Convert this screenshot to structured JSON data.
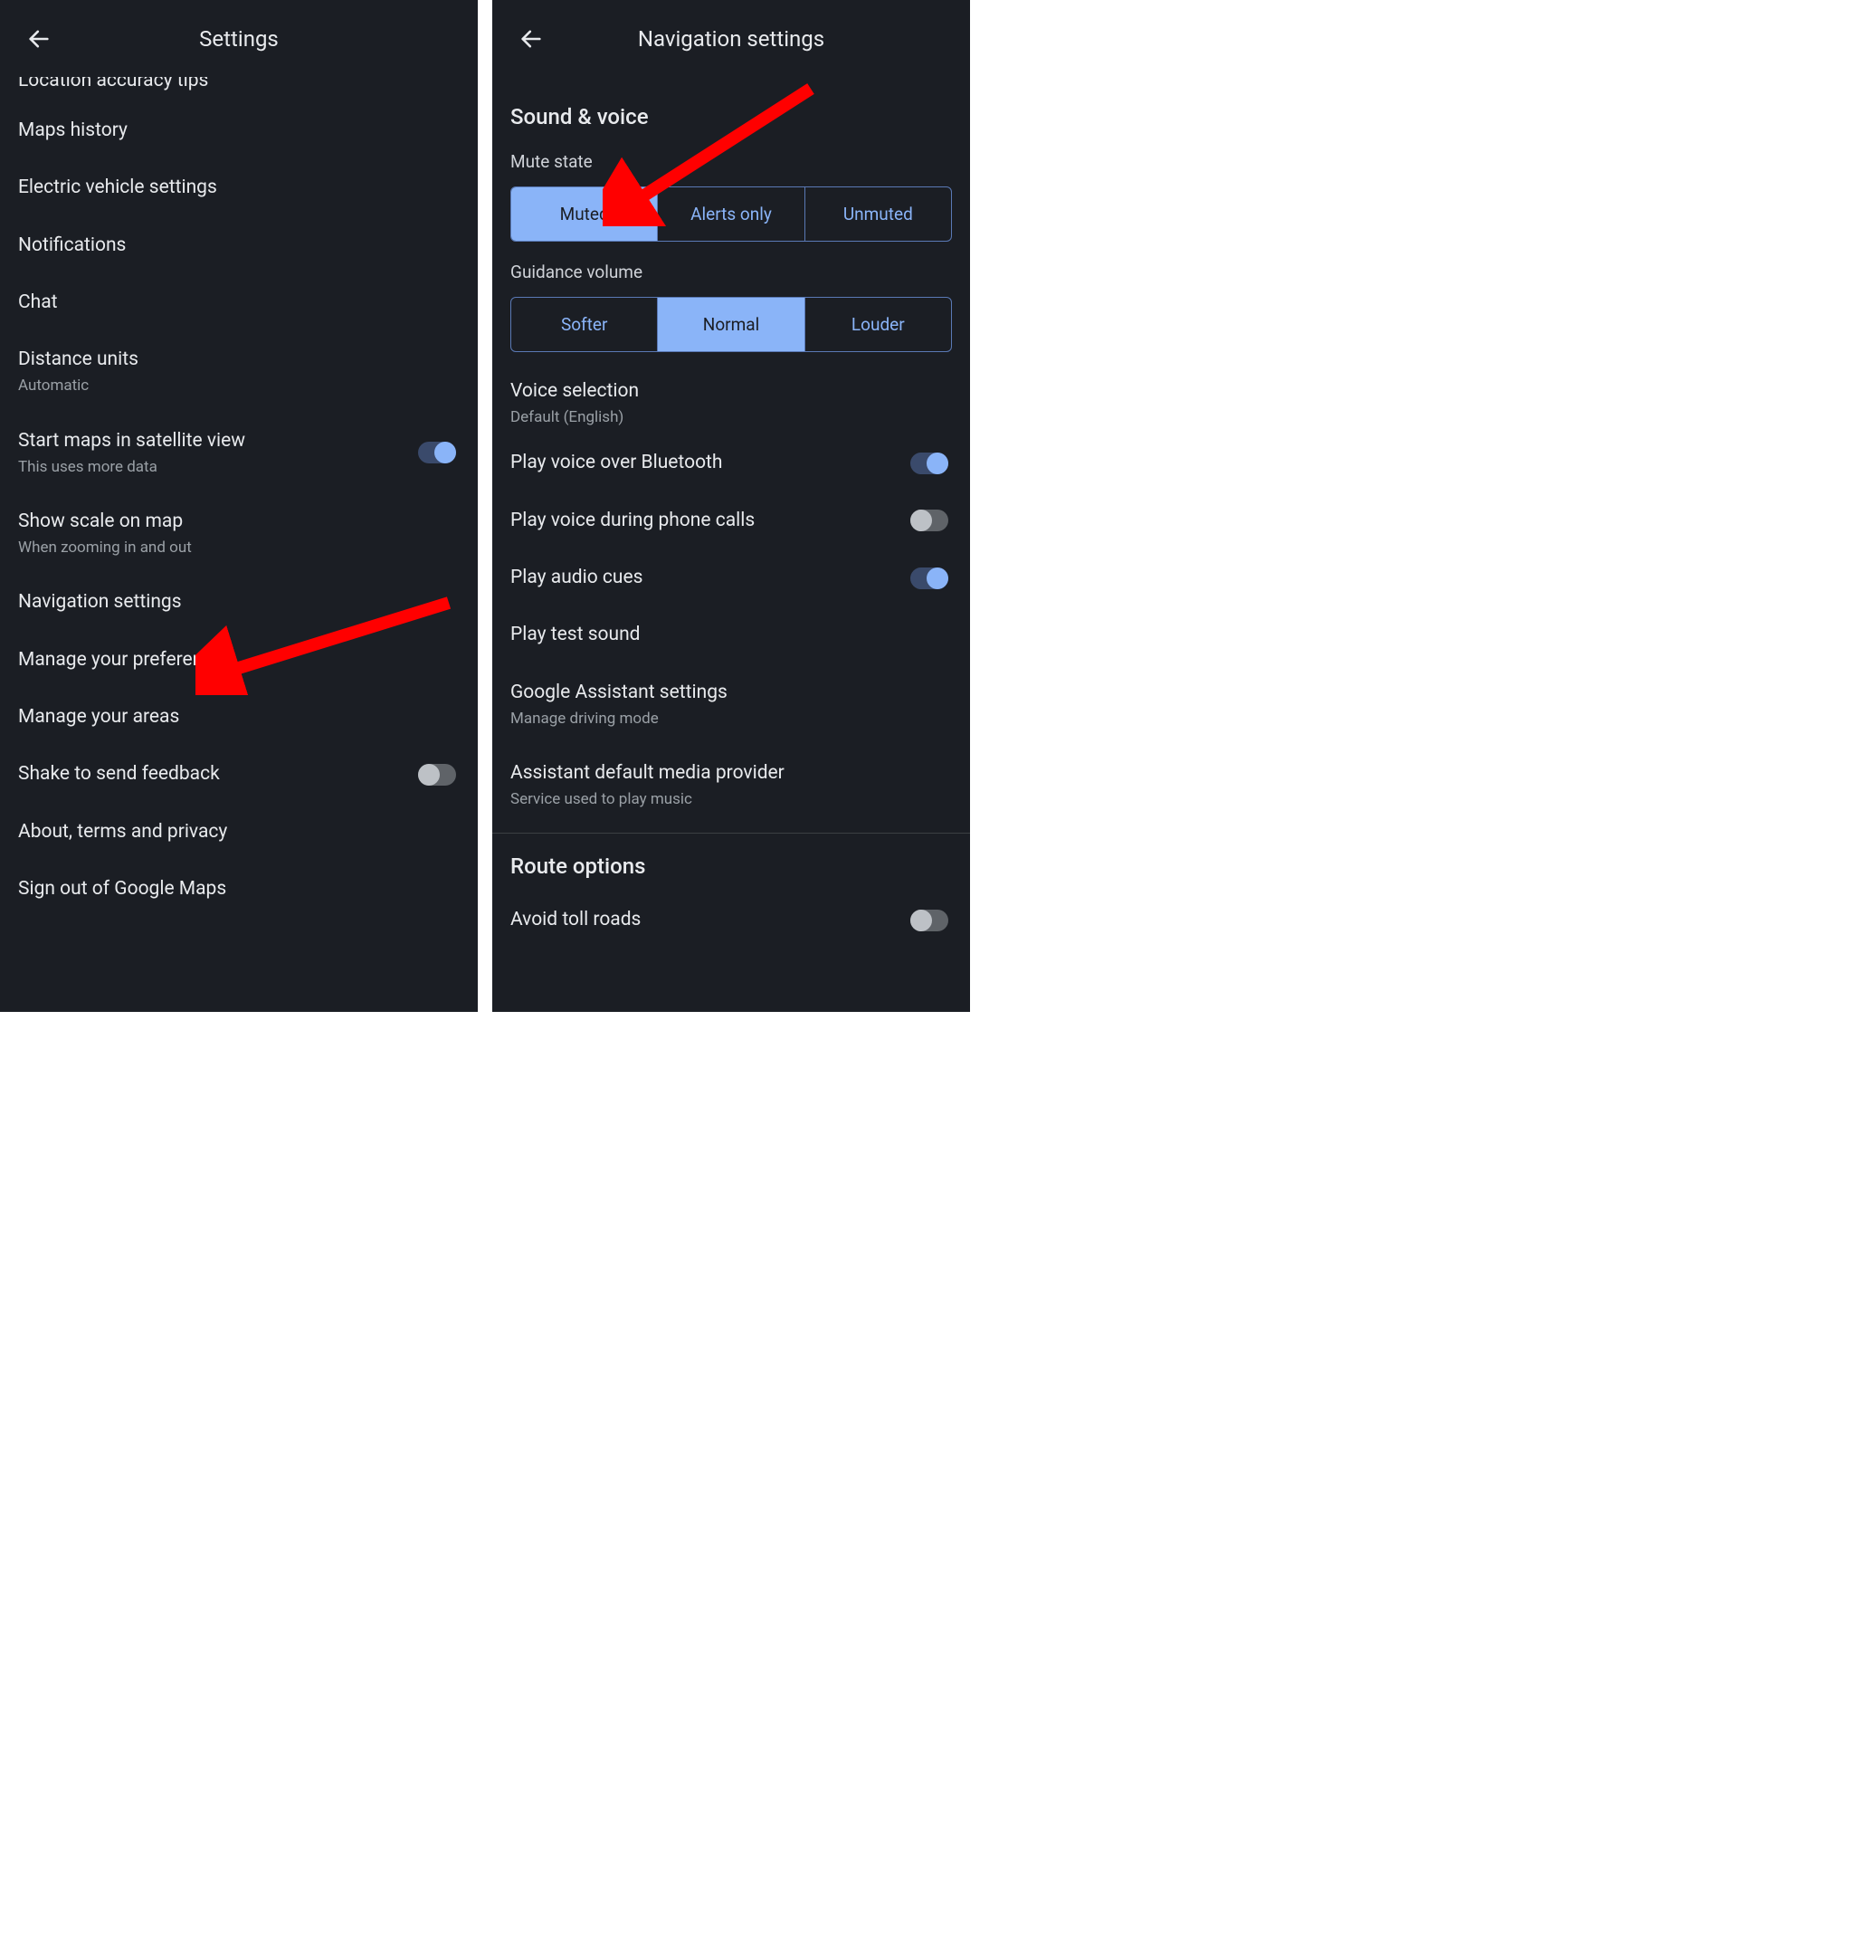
{
  "left": {
    "title": "Settings",
    "truncated": "Location accuracy tips",
    "items": [
      {
        "title": "Maps history"
      },
      {
        "title": "Electric vehicle settings"
      },
      {
        "title": "Notifications"
      },
      {
        "title": "Chat"
      },
      {
        "title": "Distance units",
        "sub": "Automatic"
      },
      {
        "title": "Start maps in satellite view",
        "sub": "This uses more data",
        "toggle": "on"
      },
      {
        "title": "Show scale on map",
        "sub": "When zooming in and out"
      },
      {
        "title": "Navigation settings"
      },
      {
        "title": "Manage your preferences"
      },
      {
        "title": "Manage your areas"
      },
      {
        "title": "Shake to send feedback",
        "toggle": "off"
      },
      {
        "title": "About, terms and privacy"
      },
      {
        "title": "Sign out of Google Maps"
      }
    ]
  },
  "right": {
    "title": "Navigation settings",
    "section_sound": "Sound & voice",
    "mute_label": "Mute state",
    "mute_options": [
      "Muted",
      "Alerts only",
      "Unmuted"
    ],
    "volume_label": "Guidance volume",
    "volume_options": [
      "Softer",
      "Normal",
      "Louder"
    ],
    "voice_selection": {
      "title": "Voice selection",
      "sub": "Default (English)"
    },
    "rows": [
      {
        "title": "Play voice over Bluetooth",
        "toggle": "on"
      },
      {
        "title": "Play voice during phone calls",
        "toggle": "off"
      },
      {
        "title": "Play audio cues",
        "toggle": "on"
      },
      {
        "title": "Play test sound"
      },
      {
        "title": "Google Assistant settings",
        "sub": "Manage driving mode"
      },
      {
        "title": "Assistant default media provider",
        "sub": "Service used to play music"
      }
    ],
    "section_route": "Route options",
    "route_rows": [
      {
        "title": "Avoid toll roads",
        "toggle": "off"
      }
    ]
  }
}
